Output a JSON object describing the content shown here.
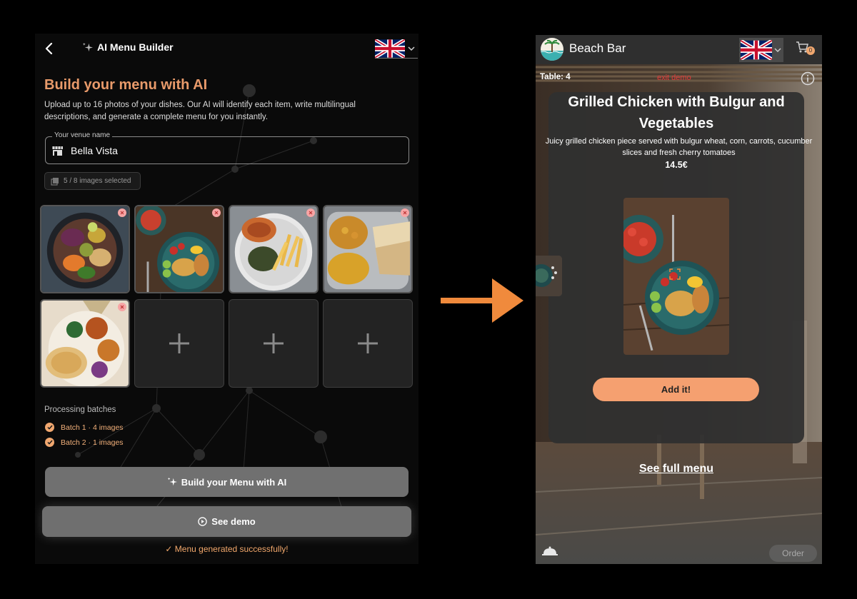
{
  "builder": {
    "title": "AI Menu Builder",
    "language": "English (UK)",
    "heading": "Build your menu with AI",
    "description": "Upload up to 16 photos of your dishes. Our AI will identify each item, write multilingual descriptions, and generate a complete menu for you instantly.",
    "venue_field": {
      "label": "Your venue name",
      "value": "Bella Vista"
    },
    "images_selected": "5 / 8 images selected",
    "photos": [
      "salad-bowl",
      "grilled-chicken-bulgur",
      "burger-fries",
      "curry-thali",
      "indian-platter"
    ],
    "empty_slots": 3,
    "batches_title": "Processing batches",
    "batches": [
      "Batch 1 · 4 images",
      "Batch 2 · 1 images"
    ],
    "build_button": "Build your Menu with AI",
    "demo_button": "See demo",
    "success_message": "✓ Menu generated successfully!"
  },
  "preview": {
    "venue_name": "Beach Bar",
    "language": "English (UK)",
    "cart_count": "0",
    "table_label": "Table: 4",
    "exit_demo": "exit demo",
    "dish": {
      "title": "Grilled Chicken with Bulgur and Vegetables",
      "description": "Juicy grilled chicken piece served with bulgur wheat, corn, carrots, cucumber slices and fresh cherry tomatoes",
      "price": "14.5€"
    },
    "add_button": "Add it!",
    "full_menu_link": "See full menu",
    "order_button": "Order"
  },
  "colors": {
    "accent": "#f5a070",
    "heading": "#e89a6a",
    "danger": "#e23a3a",
    "background": "#0a0a0a"
  }
}
